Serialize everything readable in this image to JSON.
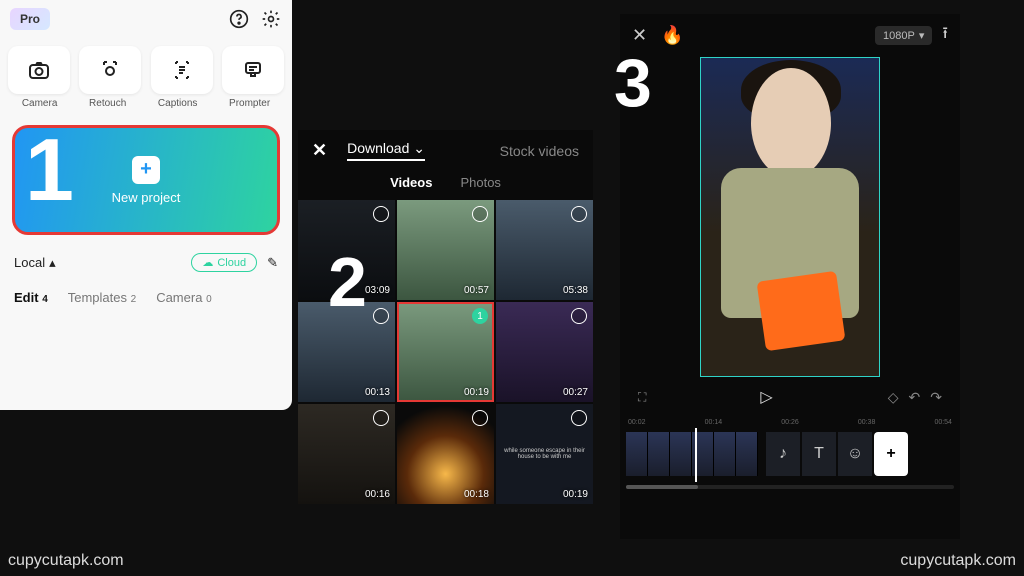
{
  "panel1": {
    "pro_label": "Pro",
    "quick": {
      "camera": "Camera",
      "retouch": "Retouch",
      "captions": "Captions",
      "prompter": "Prompter"
    },
    "step_number": "1",
    "new_project_label": "New project",
    "storage_local": "Local",
    "cloud_label": "Cloud",
    "tabs": {
      "edit": {
        "label": "Edit",
        "count": "4"
      },
      "templates": {
        "label": "Templates",
        "count": "2"
      },
      "camera": {
        "label": "Camera",
        "count": "0"
      }
    }
  },
  "panel2": {
    "step_number": "2",
    "source_download": "Download",
    "source_stock": "Stock videos",
    "subtab_videos": "Videos",
    "subtab_photos": "Photos",
    "clips": [
      {
        "dur": "03:09",
        "style": "cave"
      },
      {
        "dur": "00:57",
        "style": "forest"
      },
      {
        "dur": "05:38",
        "style": "city"
      },
      {
        "dur": "00:13",
        "style": "city"
      },
      {
        "dur": "00:19",
        "style": "forest",
        "selected": true,
        "badge": "1"
      },
      {
        "dur": "00:27",
        "style": "purple"
      },
      {
        "dur": "00:16",
        "style": "crowd"
      },
      {
        "dur": "00:18",
        "style": "fire"
      },
      {
        "dur": "00:19",
        "style": "text"
      }
    ]
  },
  "panel3": {
    "step_number": "3",
    "resolution": "1080P",
    "timeline_ticks": [
      "00:02",
      "00:14",
      "00:26",
      "00:38",
      "00:54"
    ]
  },
  "watermark": "cupycutapk.com"
}
